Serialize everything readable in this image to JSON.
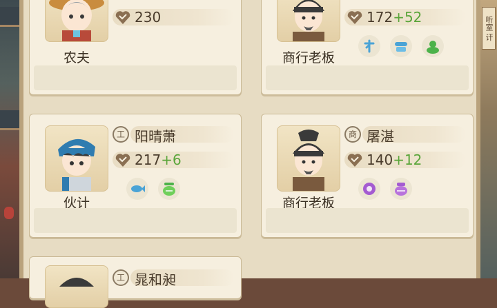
{
  "cards": [
    {
      "role": "农夫",
      "name": "",
      "stat": "230",
      "bonus": ""
    },
    {
      "role": "商行老板",
      "name": "",
      "stat": "172",
      "bonus": "+52"
    },
    {
      "role": "伙计",
      "name": "阳晴萧",
      "stat": "217",
      "bonus": "+6"
    },
    {
      "role": "商行老板",
      "name": "屠湛",
      "stat": "140",
      "bonus": "+12"
    },
    {
      "role": "",
      "name": "晁和昶",
      "stat": "",
      "bonus": ""
    }
  ],
  "badges": {
    "worker": "工",
    "merchant": "商"
  },
  "traits": {
    "card2": [
      "talent-icon",
      "cloud-icon",
      "frog-icon"
    ],
    "card3": [
      "fish-icon",
      "lantern-icon"
    ],
    "card4": [
      "purple-flower-icon",
      "purple-jar-icon"
    ]
  },
  "right_sign": "听室 讦",
  "colors": {
    "panel": "#e7dcc3",
    "card": "#f6efdf",
    "bonus_green": "#5aa53a"
  }
}
